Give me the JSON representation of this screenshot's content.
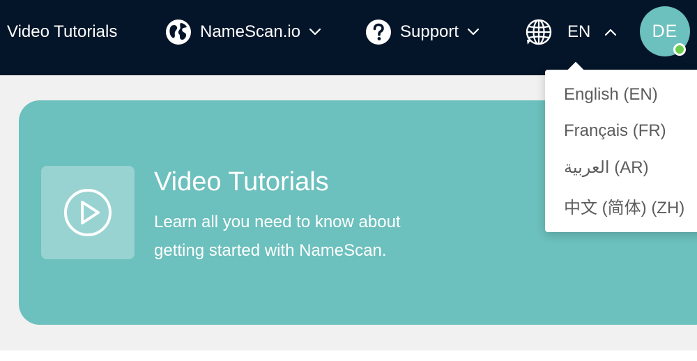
{
  "header": {
    "title": "Video Tutorials",
    "namescan_label": "NameScan.io",
    "support_label": "Support",
    "language_code": "EN",
    "avatar_initials": "DE"
  },
  "hero": {
    "title": "Video Tutorials",
    "subtitle": "Learn all you need to know about getting started with NameScan."
  },
  "language_menu": {
    "options": [
      {
        "label": "English (EN)"
      },
      {
        "label": "Français (FR)"
      },
      {
        "label": "العربية (AR)"
      },
      {
        "label": "中文 (简体) (ZH)"
      }
    ]
  },
  "colors": {
    "header_bg": "#051529",
    "accent_teal": "#6cc0bd",
    "status_online": "#6dcc4c",
    "page_bg": "#f1f1f1",
    "menu_text": "#5c5c5c"
  }
}
